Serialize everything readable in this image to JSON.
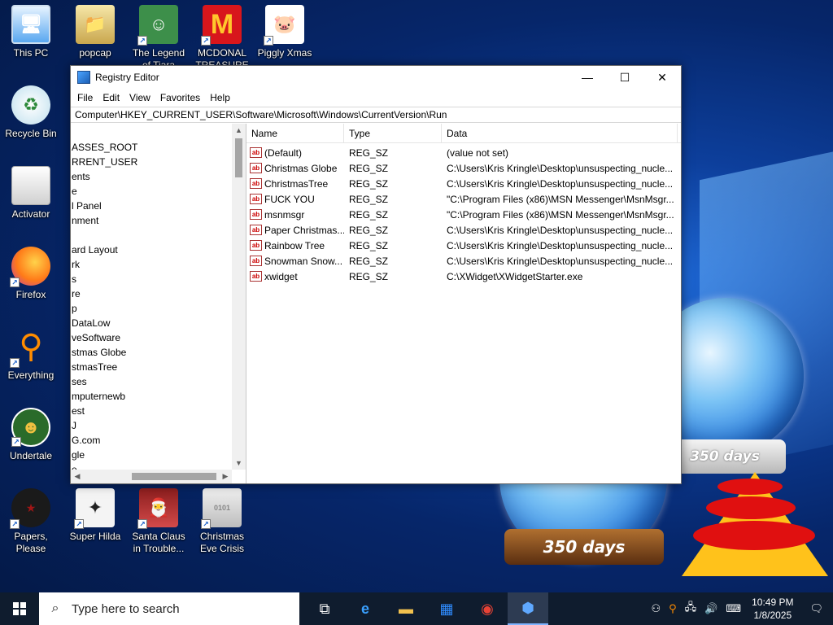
{
  "desktop_icons": [
    {
      "label": "This PC",
      "icon": "computer-icon",
      "color": "#5aa8f0"
    },
    {
      "label": "popcap",
      "icon": "folder-icon",
      "color": "#e9c868"
    },
    {
      "label": "The Legend of Tiara",
      "icon": "game-icon",
      "color": "#3d8f4a"
    },
    {
      "label": "MCDONAL TREASURE",
      "icon": "mcdonalds-icon",
      "color": "#d8161c"
    },
    {
      "label": "Piggly Xmas",
      "icon": "pig-icon",
      "color": "#e58bd6"
    },
    {
      "label": "Recycle Bin",
      "icon": "recycle-bin-icon",
      "color": "#cfe8f3"
    },
    {
      "label": "Activator",
      "icon": "file-icon",
      "color": "#e8e8e8"
    },
    {
      "label": "Firefox",
      "icon": "firefox-icon",
      "color": "#ff7a18"
    },
    {
      "label": "Everything",
      "icon": "everything-search-icon",
      "color": "#ff8c00"
    },
    {
      "label": "Undertale",
      "icon": "undertale-icon",
      "color": "#3b8a3b"
    },
    {
      "label": "Papers, Please",
      "icon": "papers-please-icon",
      "color": "#a01616"
    },
    {
      "label": "Super Hilda",
      "icon": "hilda-icon",
      "color": "#f0f0f0"
    },
    {
      "label": "Santa Claus in Trouble... A...",
      "icon": "santa-icon",
      "color": "#b03030"
    },
    {
      "label": "Christmas Eve Crisis",
      "icon": "binary-file-icon",
      "color": "#d0d0d0"
    }
  ],
  "window": {
    "title": "Registry Editor",
    "controls": {
      "minimize": "—",
      "maximize": "☐",
      "close": "✕"
    },
    "menu": [
      "File",
      "Edit",
      "View",
      "Favorites",
      "Help"
    ],
    "address": "Computer\\HKEY_CURRENT_USER\\Software\\Microsoft\\Windows\\CurrentVersion\\Run",
    "tree_items": [
      "ASSES_ROOT",
      "RRENT_USER",
      "ents",
      "e",
      "l Panel",
      "nment",
      "",
      "ard Layout",
      "rk",
      "s",
      "re",
      "p",
      "DataLow",
      "veSoftware",
      "stmas Globe",
      "stmasTree",
      "ses",
      "mputernewb",
      "est",
      "J",
      "G.com",
      "gle",
      "e"
    ],
    "columns": [
      "Name",
      "Type",
      "Data"
    ],
    "rows": [
      {
        "name": "(Default)",
        "type": "REG_SZ",
        "data": "(value not set)"
      },
      {
        "name": "Christmas Globe",
        "type": "REG_SZ",
        "data": "C:\\Users\\Kris Kringle\\Desktop\\unsuspecting_nucle..."
      },
      {
        "name": "ChristmasTree",
        "type": "REG_SZ",
        "data": "C:\\Users\\Kris Kringle\\Desktop\\unsuspecting_nucle..."
      },
      {
        "name": "FUCK YOU",
        "type": "REG_SZ",
        "data": "\"C:\\Program Files (x86)\\MSN Messenger\\MsnMsgr..."
      },
      {
        "name": "msnmsgr",
        "type": "REG_SZ",
        "data": "\"C:\\Program Files (x86)\\MSN Messenger\\MsnMsgr..."
      },
      {
        "name": "Paper Christmas...",
        "type": "REG_SZ",
        "data": "C:\\Users\\Kris Kringle\\Desktop\\unsuspecting_nucle..."
      },
      {
        "name": "Rainbow Tree",
        "type": "REG_SZ",
        "data": "C:\\Users\\Kris Kringle\\Desktop\\unsuspecting_nucle..."
      },
      {
        "name": "Snowman Snow...",
        "type": "REG_SZ",
        "data": "C:\\Users\\Kris Kringle\\Desktop\\unsuspecting_nucle..."
      },
      {
        "name": "xwidget",
        "type": "REG_SZ",
        "data": "C:\\XWidget\\XWidgetStarter.exe"
      }
    ]
  },
  "widgets": {
    "globe_small_label": "350 days",
    "globe_large_label": "350 days"
  },
  "taskbar": {
    "search_placeholder": "Type here to search",
    "apps": [
      "task-view-icon",
      "edge-icon",
      "file-explorer-icon",
      "store-icon",
      "chrome-icon",
      "regedit-icon"
    ],
    "clock_time": "10:49 PM",
    "clock_date": "1/8/2025"
  },
  "colors": {
    "accent": "#0078d7",
    "taskbar": "#0f1c2e"
  }
}
